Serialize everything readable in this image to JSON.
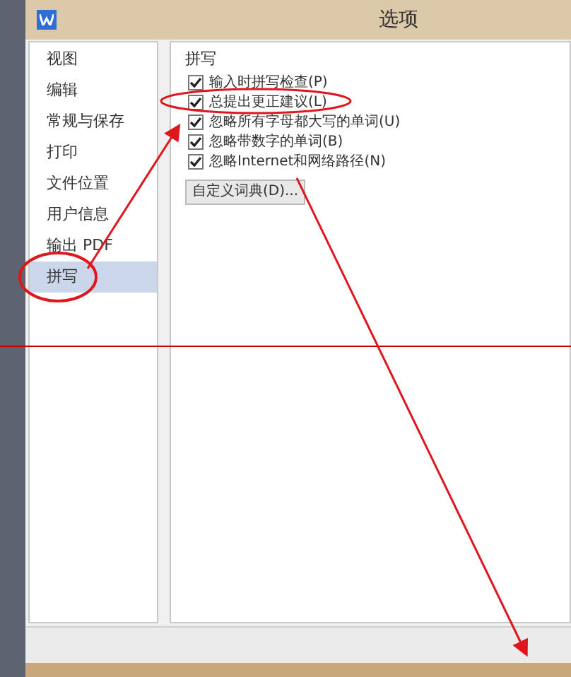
{
  "window": {
    "title": "选项"
  },
  "sidebar": {
    "items": [
      {
        "label": "视图",
        "selected": false
      },
      {
        "label": "编辑",
        "selected": false
      },
      {
        "label": "常规与保存",
        "selected": false
      },
      {
        "label": "打印",
        "selected": false
      },
      {
        "label": "文件位置",
        "selected": false
      },
      {
        "label": "用户信息",
        "selected": false
      },
      {
        "label": "输出 PDF",
        "selected": false
      },
      {
        "label": "拼写",
        "selected": true
      }
    ]
  },
  "spelling": {
    "title": "拼写",
    "options": [
      {
        "label": "输入时拼写检查(P)",
        "checked": true
      },
      {
        "label": "总提出更正建议(L)",
        "checked": true
      },
      {
        "label": "忽略所有字母都大写的单词(U)",
        "checked": true
      },
      {
        "label": "忽略带数字的单词(B)",
        "checked": true
      },
      {
        "label": "忽略Internet和网络路径(N)",
        "checked": true
      }
    ],
    "button": "自定义词典(D)..."
  }
}
